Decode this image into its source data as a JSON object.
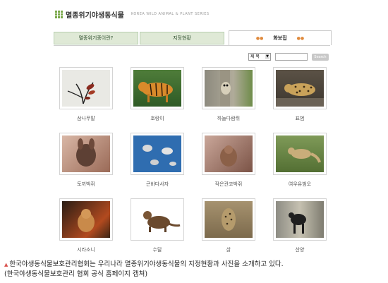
{
  "header": {
    "title": "멸종위기야생동식물",
    "subtitle": "KOREA WILD ANIMAL & PLANT SERIES"
  },
  "tabs": [
    {
      "label": "멸종위기종이란?"
    },
    {
      "label": "지정현황"
    },
    {
      "label": "화보집"
    }
  ],
  "search": {
    "field": "제 목",
    "button": "Search"
  },
  "gallery": [
    {
      "name": "삼나무말"
    },
    {
      "name": "호랑이"
    },
    {
      "name": "하늘다람쥐"
    },
    {
      "name": "표범"
    },
    {
      "name": "토끼박쥐"
    },
    {
      "name": "큰바다사자"
    },
    {
      "name": "작은관코박쥐"
    },
    {
      "name": "여우유범오"
    },
    {
      "name": "시라소니"
    },
    {
      "name": "수달"
    },
    {
      "name": "삵"
    },
    {
      "name": "산양"
    }
  ],
  "caption": {
    "line1": "한국야생동식물보호관리협회는 우리나라 멸종위기야생동식물의 지정현황과 사진을 소개하고 있다.",
    "line2": "(한국야생동식물보호관리 협회 공식 홈페이지 캡쳐)"
  }
}
